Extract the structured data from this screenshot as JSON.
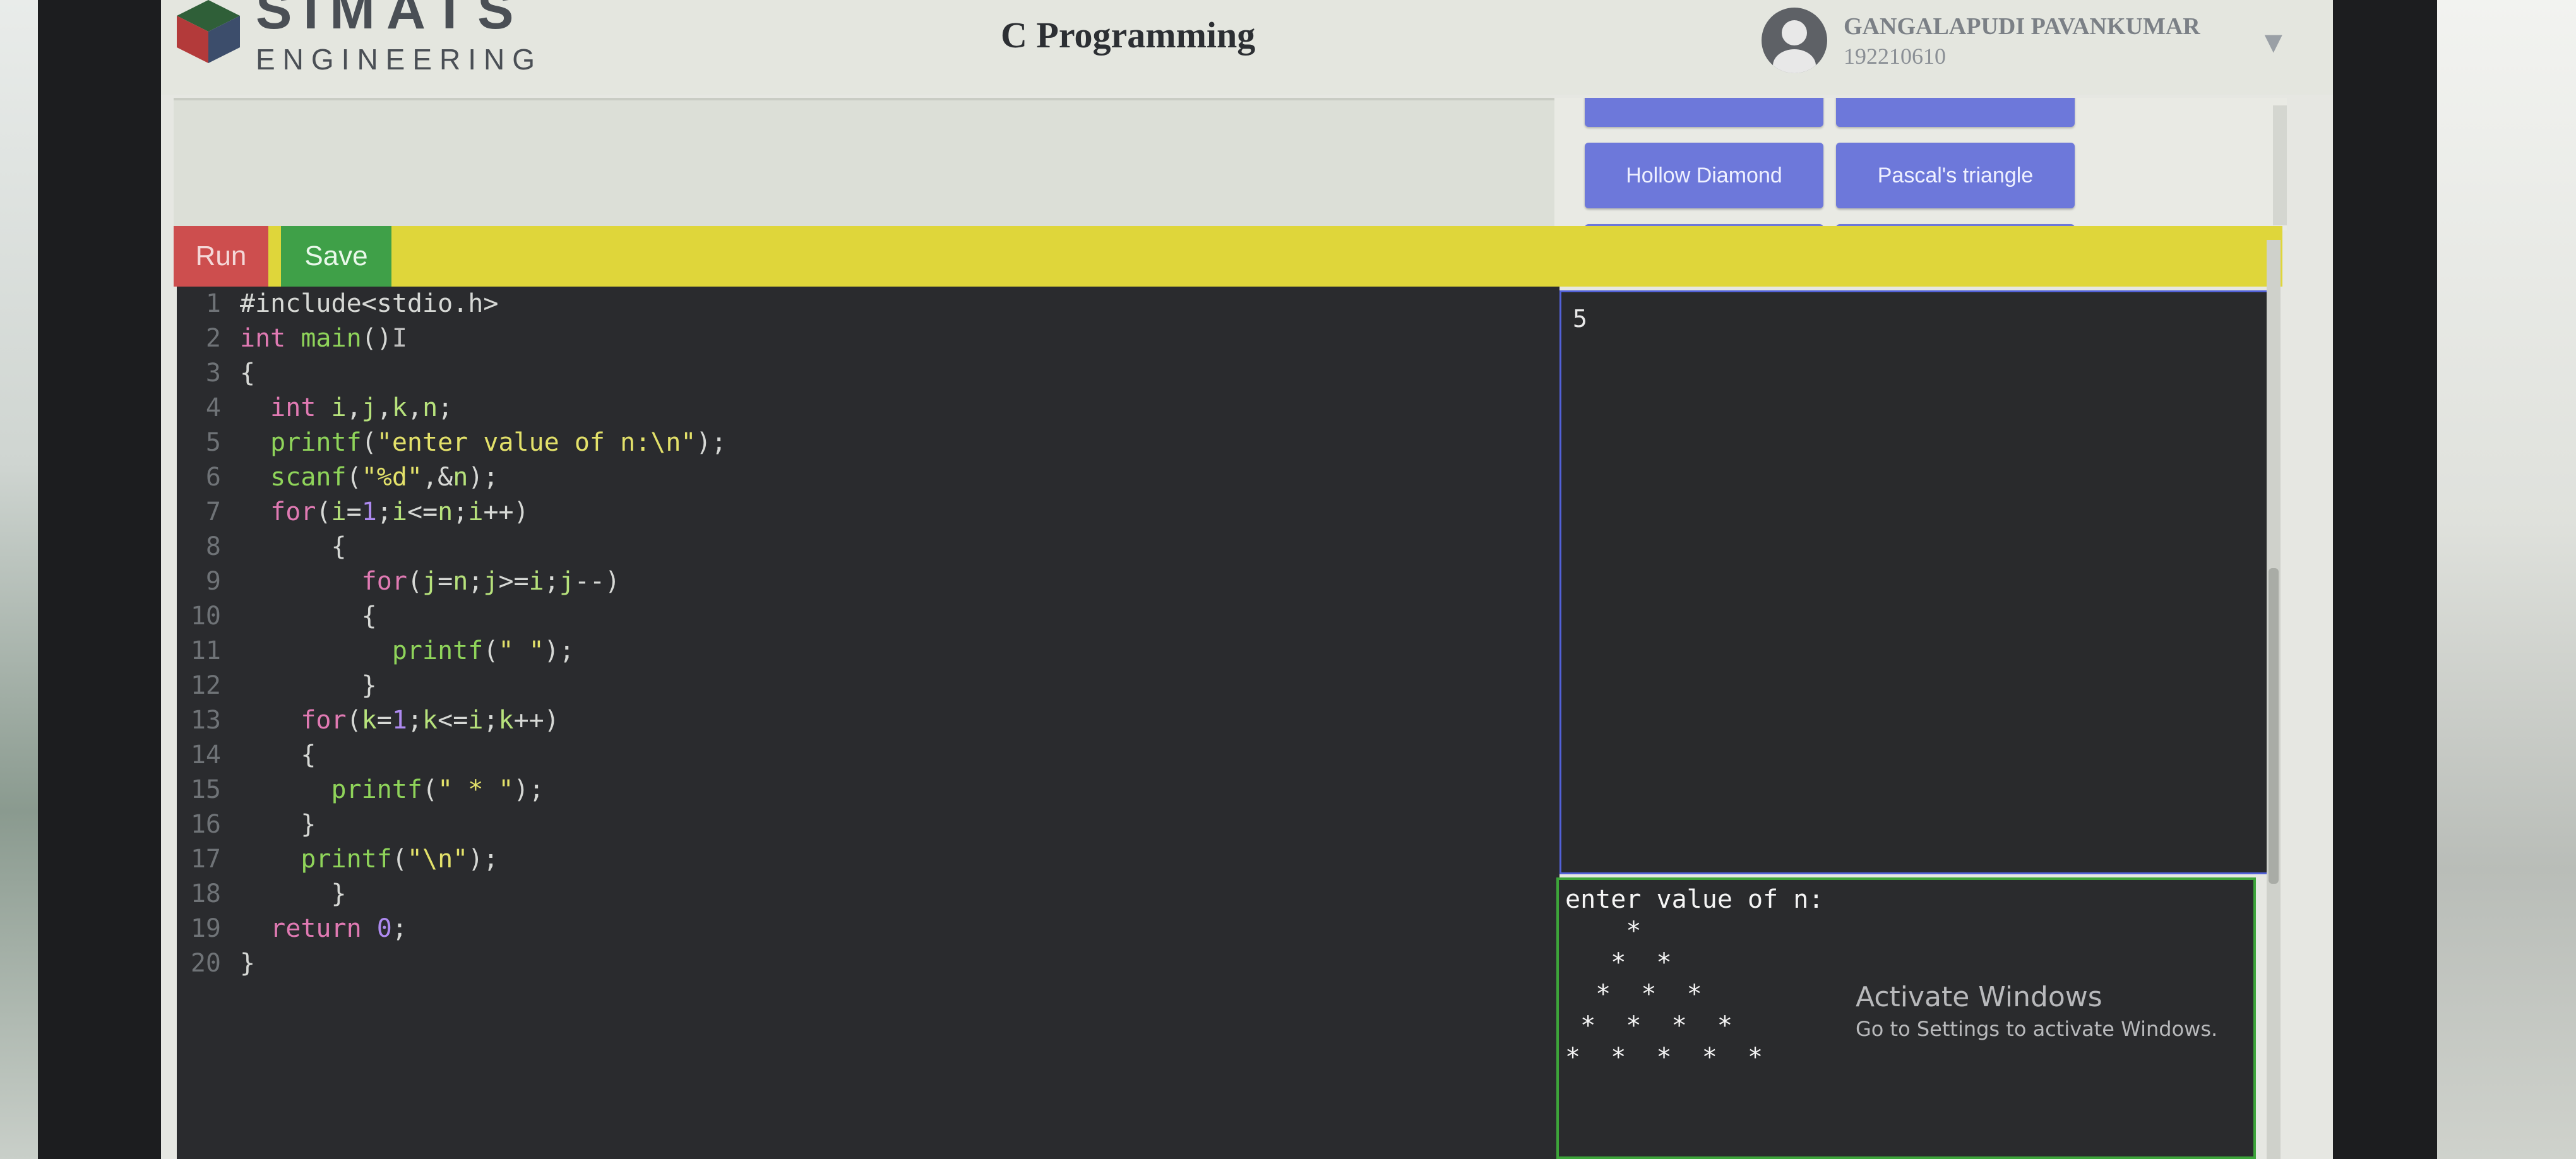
{
  "header": {
    "brand_top": "SIMATS",
    "brand_bottom": "ENGINEERING",
    "title": "C Programming",
    "user_name": "GANGALAPUDI PAVANKUMAR",
    "user_id": "192210610",
    "menu_icon": "triangle-down-icon"
  },
  "program_buttons": {
    "partial_top_left": "",
    "partial_top_right": "",
    "hollow_diamond": "Hollow Diamond",
    "pascals_triangle": "Pascal's triangle",
    "partial_bottom_left": "",
    "partial_bottom_right": ""
  },
  "toolbar": {
    "run": "Run",
    "save": "Save"
  },
  "editor": {
    "line_numbers": [
      "1",
      "2",
      "3",
      "4",
      "5",
      "6",
      "7",
      "8",
      "9",
      "10",
      "11",
      "12",
      "13",
      "14",
      "15",
      "16",
      "17",
      "18",
      "19",
      "20"
    ]
  },
  "input": {
    "value": "5"
  },
  "output": {
    "lines": [
      "enter value of n:",
      "    *",
      "   *  *",
      "  *  *  *",
      " *  *  *  *",
      "*  *  *  *  *"
    ]
  },
  "watermark": {
    "title": "Activate Windows",
    "subtitle": "Go to Settings to activate Windows."
  },
  "colors": {
    "accent_blue": "#6d78da",
    "run_red": "#cd4e4e",
    "save_green": "#3fa048",
    "toolbar_yellow": "#dfd63a",
    "output_border": "#3da53a",
    "input_border": "#5261d8"
  }
}
